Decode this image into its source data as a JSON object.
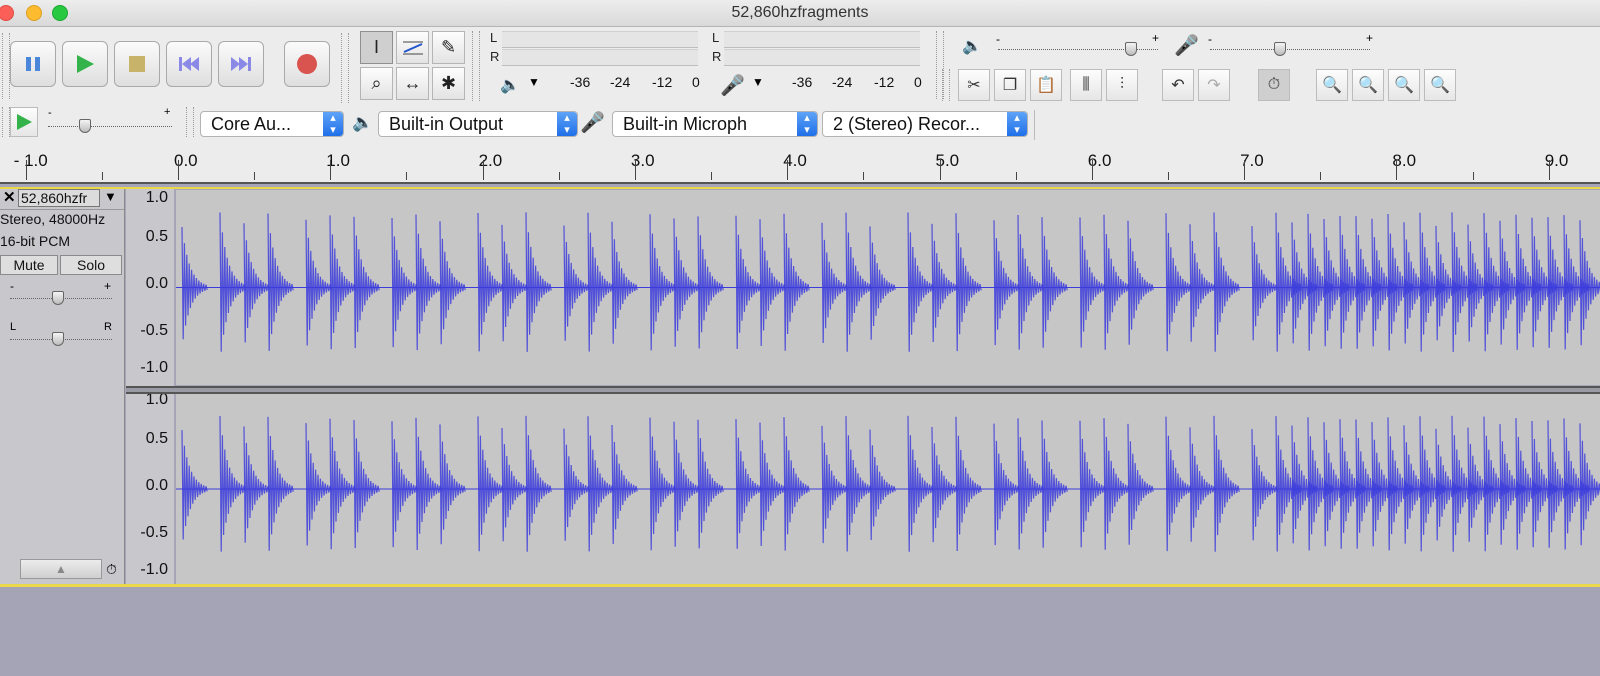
{
  "window": {
    "title": "52,860hzfragments"
  },
  "transport": {
    "pause": "pause-icon",
    "play": "play-icon",
    "stop": "stop-icon",
    "skip_start": "skip-start-icon",
    "skip_end": "skip-end-icon",
    "record": "record-icon"
  },
  "tools": [
    "selection-tool-icon",
    "envelope-tool-icon",
    "draw-tool-icon",
    "zoom-tool-icon",
    "timeshift-tool-icon",
    "multi-tool-icon"
  ],
  "meters": {
    "play_l": "L",
    "play_r": "R",
    "rec_l": "L",
    "rec_r": "R",
    "scale": [
      "-36",
      "-24",
      "-12",
      "0"
    ]
  },
  "mixer": {
    "output_icon": "speaker-icon",
    "input_icon": "microphone-icon",
    "output_level": 0.83,
    "input_level": 0.44
  },
  "play_at_speed": {
    "level": 0.3
  },
  "devices": {
    "host": "Core Au...",
    "output": "Built-in Output",
    "input": "Built-in Microph",
    "channels": "2 (Stereo) Recor..."
  },
  "ruler": {
    "labels": [
      "- 1.0",
      "0.0",
      "1.0",
      "2.0",
      "3.0",
      "4.0",
      "5.0",
      "6.0",
      "7.0",
      "8.0",
      "9.0"
    ]
  },
  "track": {
    "name": "52,860hzfr",
    "format": "Stereo, 48000Hz",
    "bits": "16-bit PCM",
    "mute": "Mute",
    "solo": "Solo",
    "gain_minus": "-",
    "gain_plus": "+",
    "pan_l": "L",
    "pan_r": "R",
    "yticks": [
      "1.0",
      "0.5",
      "0.0",
      "-0.5",
      "-1.0"
    ]
  },
  "colors": {
    "waveform": "#3c3cdc",
    "selection_line": "#e8d84a",
    "record": "#d9534f",
    "play": "#34b34a"
  }
}
